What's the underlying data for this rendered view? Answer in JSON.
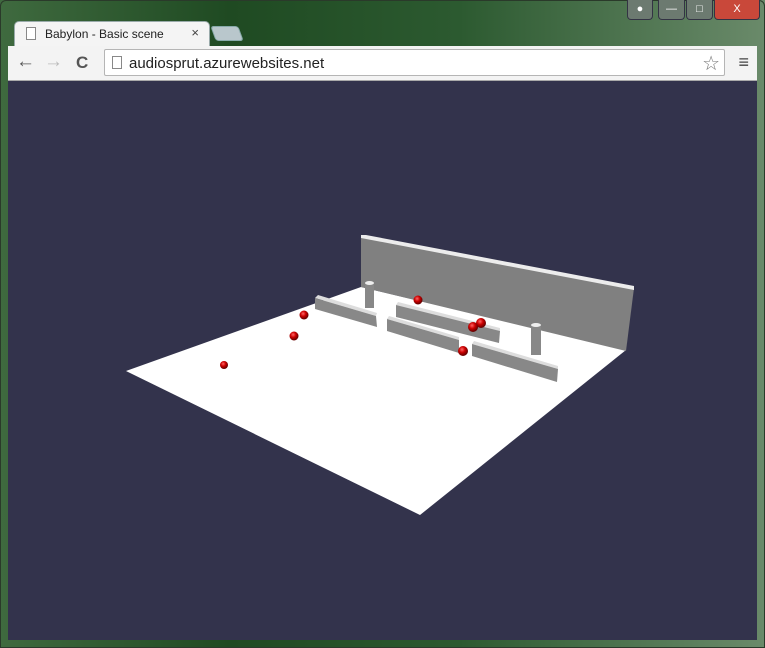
{
  "window": {
    "user_icon": "user-icon",
    "minimize_icon": "minimize-icon",
    "maximize_icon": "maximize-icon",
    "close_icon": "close-icon",
    "close_label": "X"
  },
  "tab": {
    "title": "Babylon - Basic scene",
    "close": "×"
  },
  "toolbar": {
    "back": "←",
    "forward": "→",
    "reload": "C",
    "url": "audiosprut.azurewebsites.net",
    "star": "☆",
    "menu": "≡"
  },
  "scene": {
    "background": "#33334c",
    "ground": "#ffffff",
    "wall": "#808080",
    "sphere": "#cc0000"
  }
}
